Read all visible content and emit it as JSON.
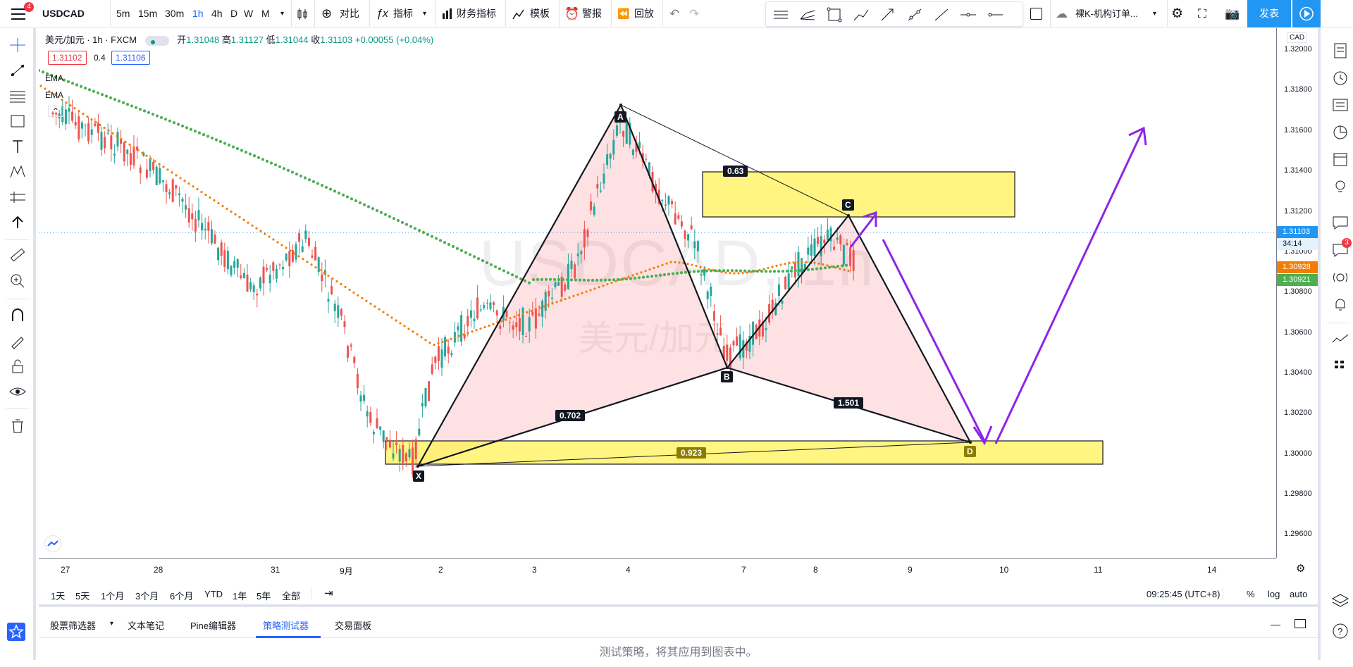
{
  "header": {
    "symbol": "USDCAD",
    "notification_count": "4",
    "intervals": [
      "5m",
      "15m",
      "30m",
      "1h",
      "4h",
      "D",
      "W",
      "M"
    ],
    "active_interval": "1h",
    "compare_label": "对比",
    "indicators_label": "指标",
    "financials_label": "财务指标",
    "templates_label": "模板",
    "alerts_label": "警报",
    "replay_label": "回放",
    "layout_name": "裸K-机构订单...",
    "publish_label": "发表"
  },
  "legend": {
    "title": "美元/加元 · 1h · FXCM",
    "open_label": "开",
    "open": "1.31048",
    "high_label": "高",
    "high": "1.31127",
    "low_label": "低",
    "low": "1.31044",
    "close_label": "收",
    "close": "1.31103",
    "change": "+0.00055 (+0.04%)",
    "bid": "1.31102",
    "spread": "0.4",
    "ask": "1.31106",
    "ema1": "EMA",
    "ema2": "EMA"
  },
  "watermark": {
    "symbol": "USDCAD, 1h",
    "name": "美元/加元"
  },
  "price_axis": {
    "currency": "CAD",
    "labels": [
      "1.32000",
      "1.31800",
      "1.31600",
      "1.31400",
      "1.31200",
      "1.31000",
      "1.30800",
      "1.30600",
      "1.30400",
      "1.30200",
      "1.30000",
      "1.29800",
      "1.29600"
    ],
    "last_price": "1.31103",
    "countdown": "34:14",
    "ema_orange": "1.30928",
    "ema_green": "1.30921",
    "colors": {
      "last": "#2196f3",
      "orange": "#f57c00",
      "green": "#4caf50"
    }
  },
  "time_axis": {
    "labels": [
      "27",
      "28",
      "31",
      "9月",
      "2",
      "3",
      "4",
      "7",
      "8",
      "9",
      "10",
      "11",
      "14"
    ]
  },
  "pattern": {
    "points": [
      "X",
      "A",
      "B",
      "C",
      "D"
    ],
    "ratios": {
      "xb": "0.702",
      "ac": "0.63",
      "bd": "1.501",
      "xd": "0.923"
    }
  },
  "range_bar": {
    "ranges": [
      "1天",
      "5天",
      "1个月",
      "3个月",
      "6个月",
      "YTD",
      "1年",
      "5年",
      "全部"
    ],
    "clock": "09:25:45 (UTC+8)",
    "percent": "%",
    "log": "log",
    "auto": "auto"
  },
  "bottom_tabs": {
    "tabs": [
      "股票筛选器",
      "文本笔记",
      "Pine编辑器",
      "策略测试器",
      "交易面板"
    ],
    "active": "策略测试器",
    "message": "测试策略，将其应用到图表中。"
  },
  "right_badge": "3"
}
